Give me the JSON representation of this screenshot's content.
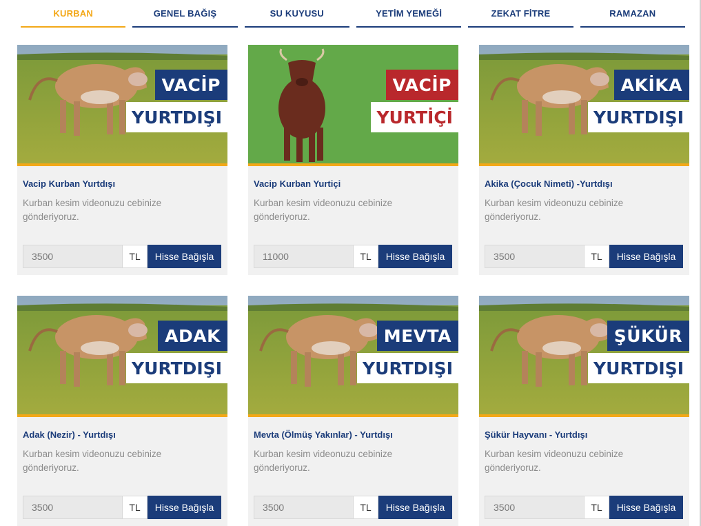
{
  "colors": {
    "navy": "#1b3c7a",
    "accent": "#f3a818",
    "red": "#b9282c",
    "card_bg": "#f1f1f1"
  },
  "tabs": [
    {
      "label": "KURBAN",
      "active": true
    },
    {
      "label": "GENEL BAĞIŞ",
      "active": false
    },
    {
      "label": "SU KUYUSU",
      "active": false
    },
    {
      "label": "YETİM YEMEĞİ",
      "active": false
    },
    {
      "label": "ZEKAT FİTRE",
      "active": false
    },
    {
      "label": "RAMAZAN",
      "active": false
    }
  ],
  "cards": [
    {
      "title": "Vacip Kurban Yurtdışı",
      "badge_top": "VACİP",
      "badge_bottom": "YURTDIŞI",
      "badge_color": "blue",
      "animal": "zebu-cow-icon",
      "description": "Kurban kesim videonuzu cebinize gönderiyoruz.",
      "amount": "3500",
      "currency": "TL",
      "button": "Hisse Bağışla"
    },
    {
      "title": "Vacip Kurban Yurtiçi",
      "badge_top": "VACİP",
      "badge_bottom": "YURTİÇİ",
      "badge_color": "red",
      "animal": "brown-bull-icon",
      "description": "Kurban kesim videonuzu cebinize gönderiyoruz.",
      "amount": "11000",
      "currency": "TL",
      "button": "Hisse Bağışla"
    },
    {
      "title": "Akika (Çocuk Nimeti) -Yurtdışı",
      "badge_top": "AKİKA",
      "badge_bottom": "YURTDIŞI",
      "badge_color": "blue",
      "animal": "zebu-cow-icon",
      "description": "Kurban kesim videonuzu cebinize gönderiyoruz.",
      "amount": "3500",
      "currency": "TL",
      "button": "Hisse Bağışla"
    },
    {
      "title": "Adak (Nezir) - Yurtdışı",
      "badge_top": "ADAK",
      "badge_bottom": "YURTDIŞI",
      "badge_color": "blue",
      "animal": "zebu-cow-icon",
      "description": "Kurban kesim videonuzu cebinize gönderiyoruz.",
      "amount": "3500",
      "currency": "TL",
      "button": "Hisse Bağışla"
    },
    {
      "title": "Mevta (Ölmüş Yakınlar) - Yurtdışı",
      "badge_top": "MEVTA",
      "badge_bottom": "YURTDIŞI",
      "badge_color": "blue",
      "animal": "zebu-cow-icon",
      "description": "Kurban kesim videonuzu cebinize gönderiyoruz.",
      "amount": "3500",
      "currency": "TL",
      "button": "Hisse Bağışla"
    },
    {
      "title": "Şükür Hayvanı - Yurtdışı",
      "badge_top": "ŞÜKÜR",
      "badge_bottom": "YURTDIŞI",
      "badge_color": "blue",
      "animal": "zebu-cow-icon",
      "description": "Kurban kesim videonuzu cebinize gönderiyoruz.",
      "amount": "3500",
      "currency": "TL",
      "button": "Hisse Bağışla"
    }
  ]
}
